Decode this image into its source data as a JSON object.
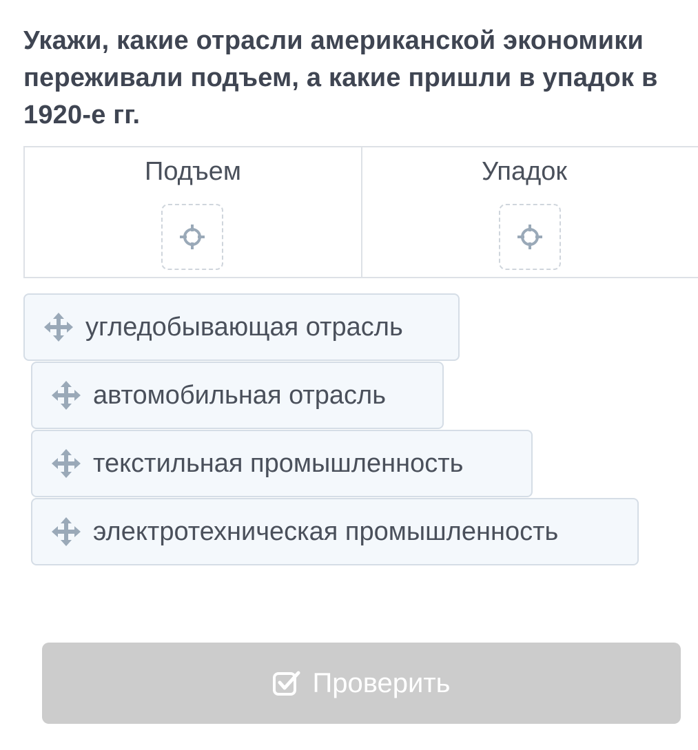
{
  "question": "Укажи, какие отрасли американской экономики переживали подъем, а какие пришли в упадок в 1920-е гг.",
  "columns": [
    {
      "title": "Подъем"
    },
    {
      "title": "Упадок"
    }
  ],
  "items": [
    {
      "label": "угледобывающая отрасль"
    },
    {
      "label": "автомобильная отрасль"
    },
    {
      "label": "текстильная промышленность"
    },
    {
      "label": "электротехническая промышленность"
    }
  ],
  "button": {
    "label": "Проверить",
    "icon": "checkbox-check-icon"
  },
  "icons": {
    "drop": "crosshair-target-icon",
    "drag": "move-arrows-icon"
  },
  "colors": {
    "button_disabled": "#cccccc",
    "item_bg": "#f4f8fc",
    "icon": "#9aa9b8"
  }
}
